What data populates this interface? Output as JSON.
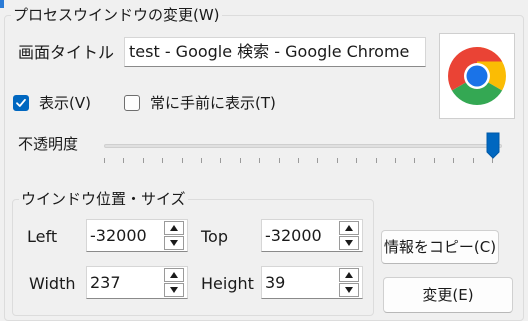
{
  "group_process": {
    "title": "プロセスウインドウの変更(W)"
  },
  "window_title": {
    "label": "画面タイトル",
    "value": "test - Google 検索 - Google Chrome"
  },
  "app_icon": {
    "name": "chrome-icon"
  },
  "show_checkbox": {
    "label": "表示(V)",
    "checked": true
  },
  "topmost_checkbox": {
    "label": "常に手前に表示(T)",
    "checked": false
  },
  "opacity": {
    "label": "不透明度",
    "value_percent": 100
  },
  "group_position": {
    "title": "ウインドウ位置・サイズ"
  },
  "fields": {
    "left": {
      "label": "Left",
      "value": "-32000"
    },
    "top": {
      "label": "Top",
      "value": "-32000"
    },
    "width": {
      "label": "Width",
      "value": "237"
    },
    "height": {
      "label": "Height",
      "value": "39"
    }
  },
  "buttons": {
    "copy": "情報をコピー(C)",
    "apply": "変更(E)"
  },
  "colors": {
    "accent": "#0067c0"
  }
}
